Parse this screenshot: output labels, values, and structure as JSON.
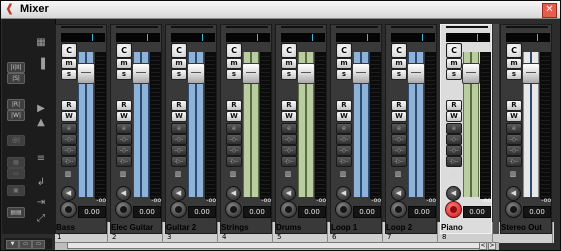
{
  "window": {
    "title": "Mixer"
  },
  "toolbar": {
    "col1": [
      "|I|II|",
      "|S|",
      "|R|",
      "|W|",
      "@|",
      "▤",
      "▭",
      "▣",
      "▤▤"
    ],
    "col2": [
      "▦",
      "▐",
      "▶",
      "▲",
      "≡",
      "↲",
      "⇥",
      "⤢"
    ],
    "bottom": [
      "▼",
      "▭",
      "▭"
    ]
  },
  "channels": [
    {
      "name": "Bass",
      "number": "1",
      "knob": "C",
      "mute": "m",
      "solo": "s",
      "read": "R",
      "write": "W",
      "edit": "e",
      "peak": "-oo",
      "volume": "0.00",
      "strip": "blue"
    },
    {
      "name": "Elec Guitar",
      "number": "2",
      "knob": "C",
      "mute": "m",
      "solo": "s",
      "read": "R",
      "write": "W",
      "edit": "e",
      "peak": "-oo",
      "volume": "0.00",
      "strip": "blue"
    },
    {
      "name": "Guitar 2",
      "number": "3",
      "knob": "C",
      "mute": "m",
      "solo": "s",
      "read": "R",
      "write": "W",
      "edit": "e",
      "peak": "-oo",
      "volume": "0.00",
      "strip": "blue"
    },
    {
      "name": "Strings",
      "number": "4",
      "knob": "C",
      "mute": "m",
      "solo": "s",
      "read": "R",
      "write": "W",
      "edit": "e",
      "peak": "-oo",
      "volume": "0.00",
      "strip": "green"
    },
    {
      "name": "Drums",
      "number": "5",
      "knob": "C",
      "mute": "m",
      "solo": "s",
      "read": "R",
      "write": "W",
      "edit": "e",
      "peak": "-oo",
      "volume": "0.00",
      "strip": "green"
    },
    {
      "name": "Loop 1",
      "number": "6",
      "knob": "C",
      "mute": "m",
      "solo": "s",
      "read": "R",
      "write": "W",
      "edit": "e",
      "peak": "-oo",
      "volume": "0.00",
      "strip": "blue"
    },
    {
      "name": "Loop 2",
      "number": "7",
      "knob": "C",
      "mute": "m",
      "solo": "s",
      "read": "R",
      "write": "W",
      "edit": "e",
      "peak": "-oo",
      "volume": "0.00",
      "strip": "blue"
    },
    {
      "name": "Piano",
      "number": "8",
      "knob": "C",
      "mute": "m",
      "solo": "s",
      "read": "R",
      "write": "W",
      "edit": "e",
      "peak": "-oo",
      "volume": "0.00",
      "strip": "green",
      "selected": true
    },
    {
      "name": "Stereo Out",
      "number": "",
      "knob": "C",
      "mute": "m",
      "solo": "s",
      "read": "R",
      "write": "W",
      "edit": "e",
      "peak": "-oo",
      "volume": "0.00",
      "strip": "white"
    }
  ],
  "scroll": {
    "left": "<",
    "right": ">"
  },
  "colors": {
    "accent_blue": "#8fb3d8",
    "accent_green": "#b9cda0",
    "record": "#cc1a1a",
    "meter_marker": "#3fb8de"
  }
}
